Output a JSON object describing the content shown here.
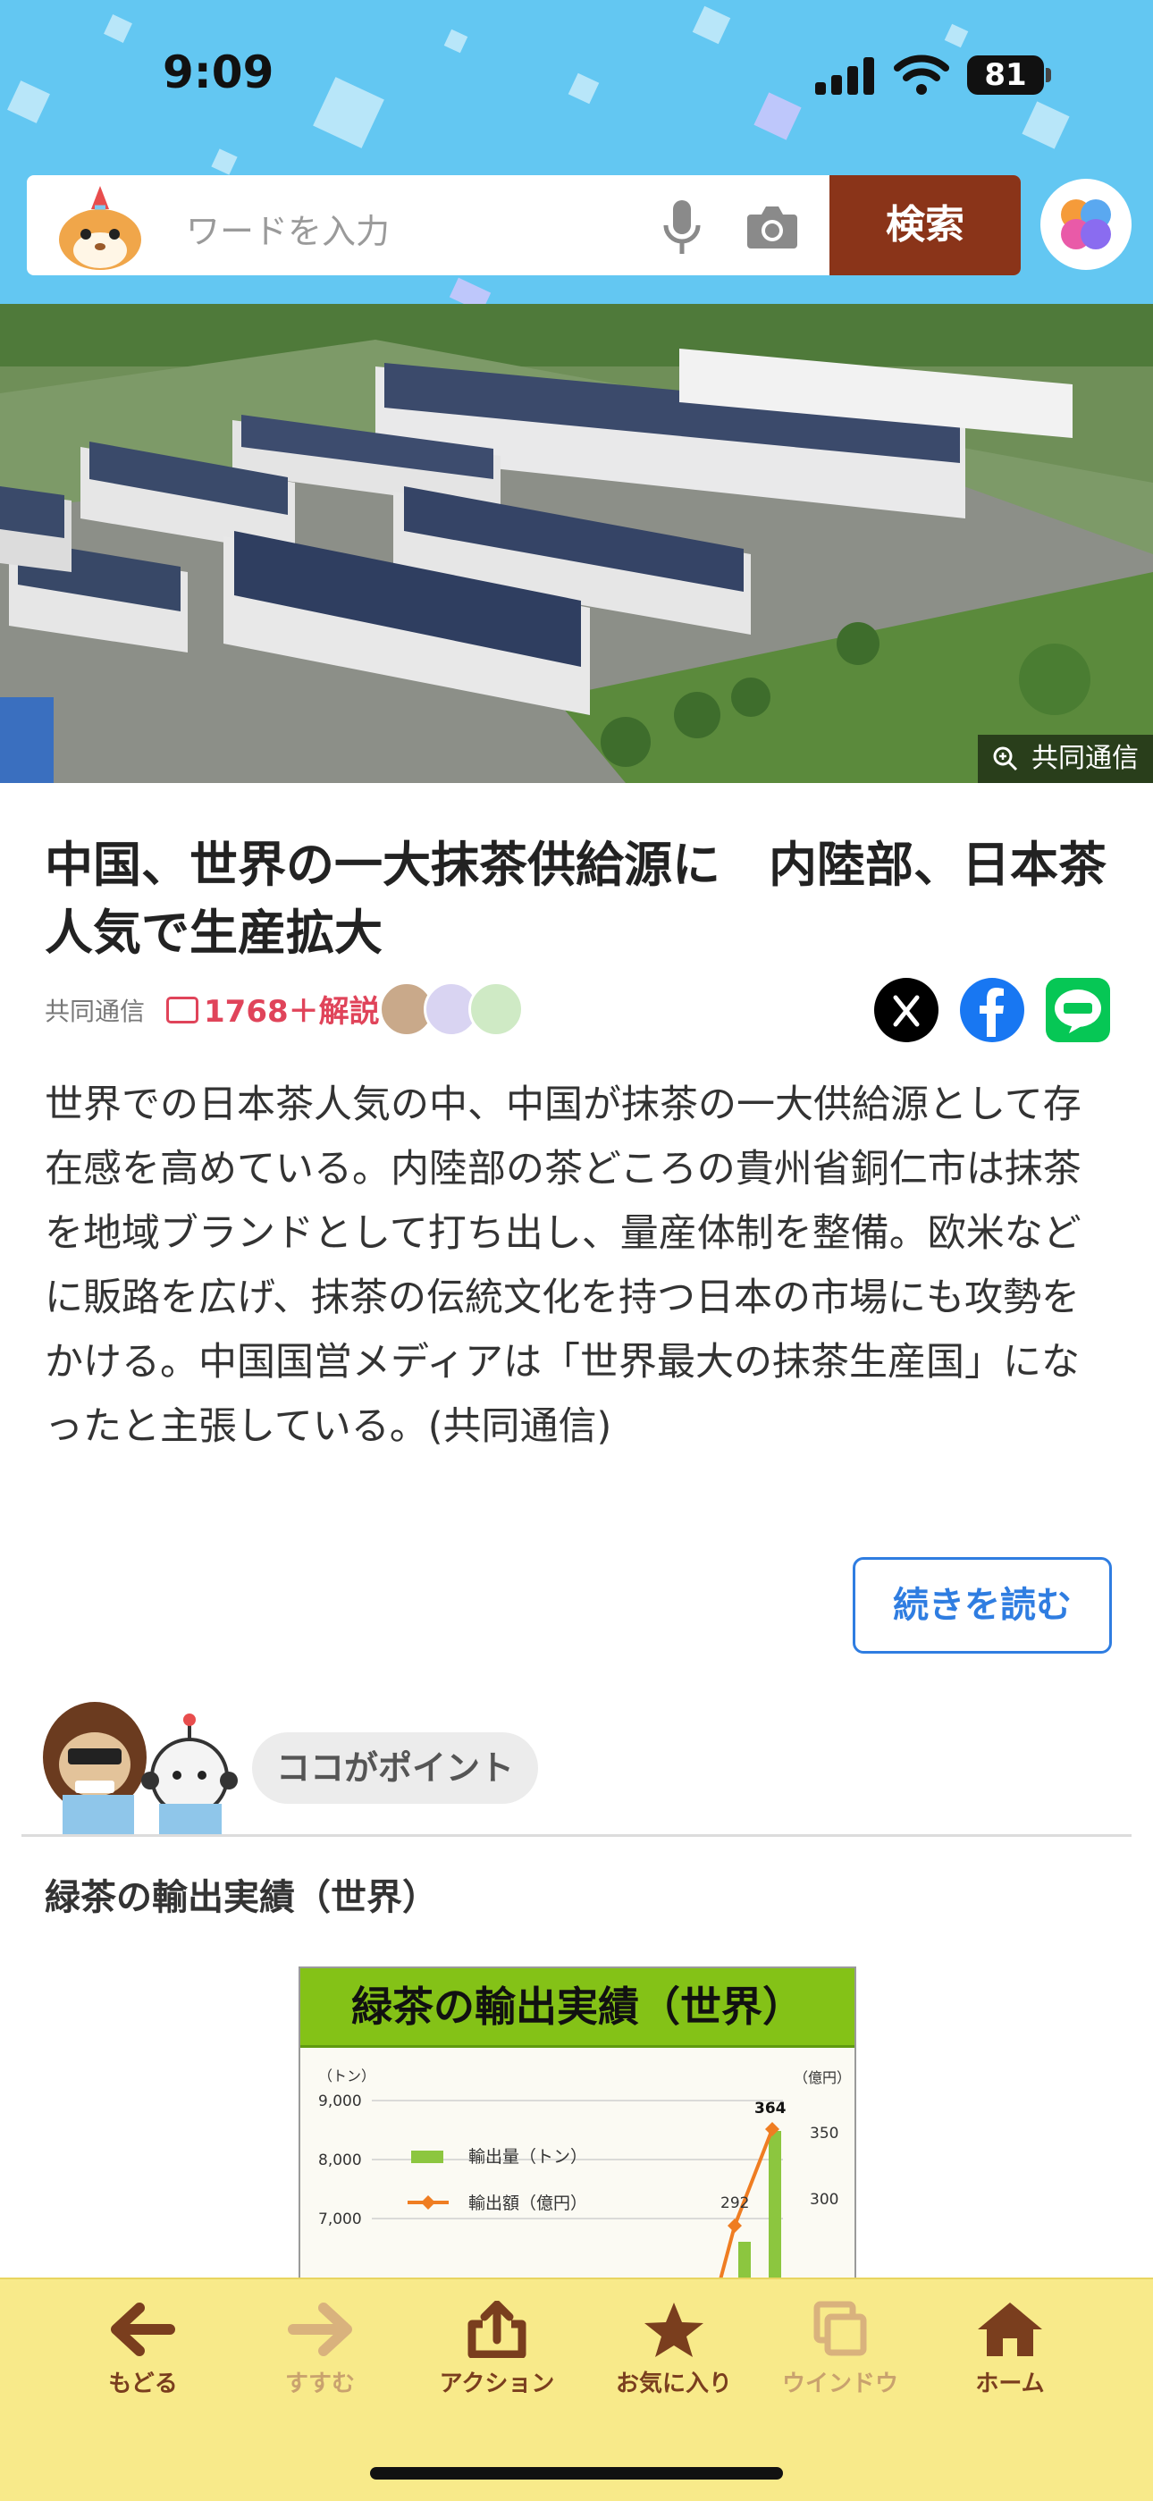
{
  "status_bar": {
    "time": "9:09",
    "battery": "81"
  },
  "search": {
    "placeholder": "ワードを入力",
    "button": "検索"
  },
  "photo": {
    "credit": "共同通信"
  },
  "article": {
    "title": "中国、世界の一大抹茶供給源に　内陸部、日本茶人気で生産拡大",
    "source": "共同通信",
    "comments": "1768＋解説",
    "body": "世界での日本茶人気の中、中国が抹茶の一大供給源として存在感を高めている。内陸部の茶どころの貴州省銅仁市は抹茶を地域ブランドとして打ち出し、量産体制を整備。欧米などに販路を広げ、抹茶の伝統文化を持つ日本の市場にも攻勢をかける。中国国営メディアは「世界最大の抹茶生産国」になったと主張している。(共同通信)",
    "read_more": "続きを読む"
  },
  "point": {
    "label": "ココがポイント",
    "section_title": "緑茶の輸出実績（世界）"
  },
  "chart_data": {
    "type": "bar",
    "title": "緑茶の輸出実績（世界）",
    "ylabel_left": "（トン）",
    "ylabel_right": "（億円）",
    "left_ticks": [
      "9,000",
      "8,000",
      "7,000"
    ],
    "right_ticks": [
      "350",
      "300"
    ],
    "legend": [
      "輸出量（トン）",
      "輸出額（億円）"
    ],
    "data_labels": [
      "292",
      "364"
    ],
    "colors": {
      "volume": "#8cc63f",
      "value": "#ef7d22"
    }
  },
  "bottom_nav": [
    {
      "label": "もどる",
      "icon": "back-arrow-icon"
    },
    {
      "label": "すすむ",
      "icon": "forward-arrow-icon"
    },
    {
      "label": "アクション",
      "icon": "share-icon"
    },
    {
      "label": "お気に入り",
      "icon": "star-icon"
    },
    {
      "label": "ウインドウ",
      "icon": "window-icon"
    },
    {
      "label": "ホーム",
      "icon": "home-icon"
    }
  ],
  "colors": {
    "header_bg": "#63c7f2",
    "search_button": "#8a3419",
    "accent_blue": "#2f7de1",
    "comment_red": "#e0445a",
    "bottom_bar": "#f8ea8a"
  }
}
